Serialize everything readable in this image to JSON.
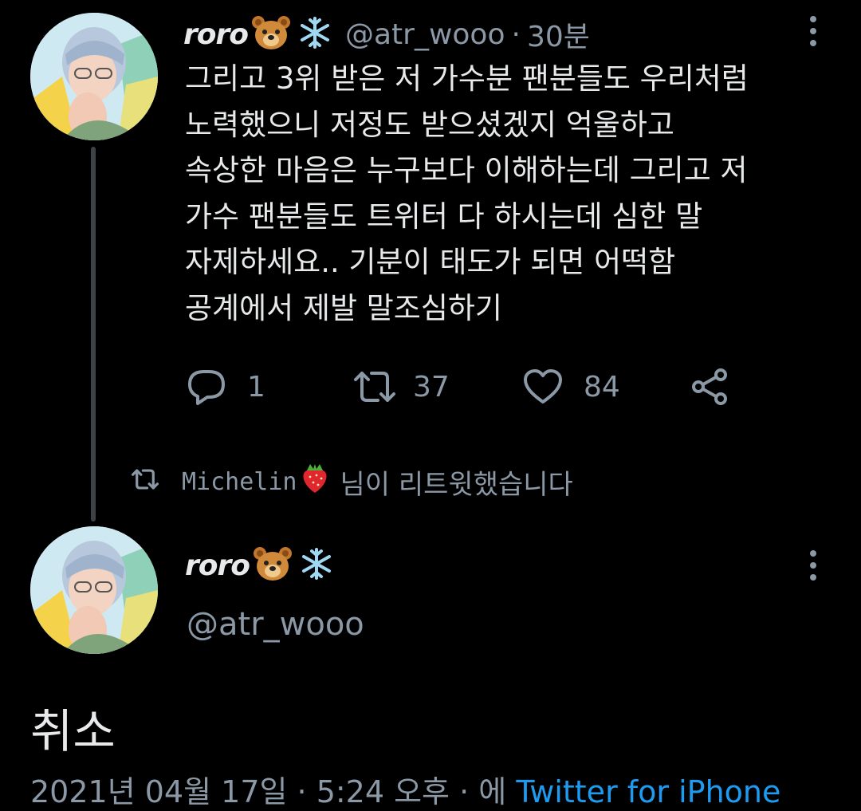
{
  "tweet1": {
    "name": "roro",
    "name_emojis": [
      "bear-face",
      "snowflake"
    ],
    "handle": "@atr_wooo",
    "separator": "·",
    "time": "30분",
    "lines": [
      "그리고 3위 받은 저 가수분 팬분들도 우리처럼",
      "노력했으니 저정도 받으셨겠지 억울하고",
      "속상한 마음은 누구보다 이해하는데 그리고 저",
      "가수 팬분들도 트위터 다 하시는데 심한 말",
      "자제하세요.. 기분이 태도가 되면 어떡함",
      "공계에서 제발 말조심하기"
    ],
    "reply_count": "1",
    "retweet_count": "37",
    "like_count": "84"
  },
  "retweet_note": {
    "user": "Michelin",
    "user_emoji": "strawberry",
    "suffix": "님이 리트윗했습니다"
  },
  "tweet2": {
    "name": "roro",
    "name_emojis": [
      "bear-face",
      "snowflake"
    ],
    "handle": "@atr_wooo",
    "text": "취소",
    "footer_date": "2021년 04월 17일 · 5:24 오후 · 에",
    "footer_source": "Twitter for iPhone"
  },
  "colors": {
    "background": "#000000",
    "text": "#e7e9ea",
    "secondary": "#8b98a5",
    "link": "#1d9bf0",
    "thread_line": "#3d4247"
  }
}
